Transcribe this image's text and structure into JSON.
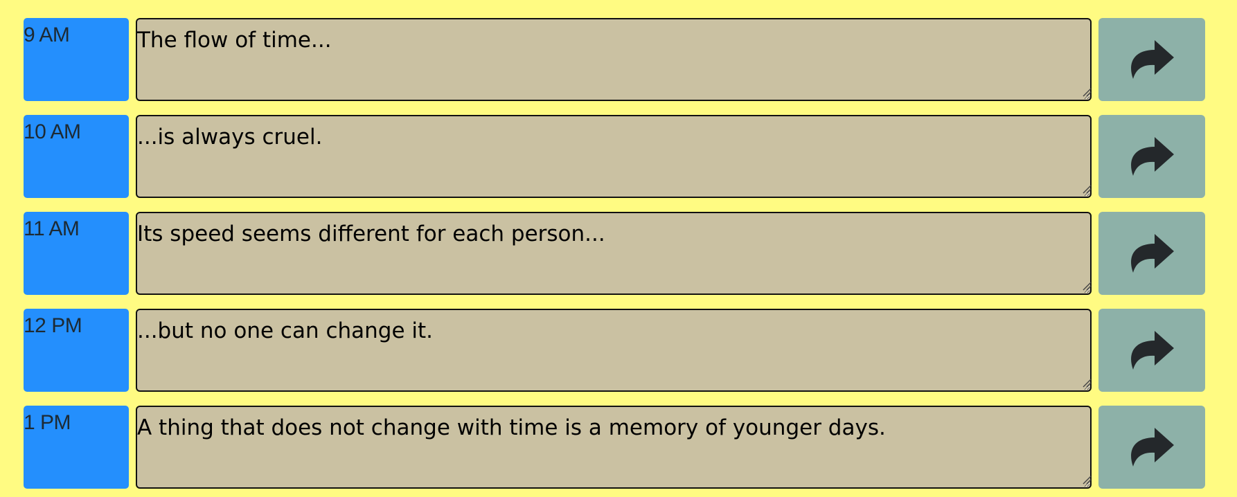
{
  "colors": {
    "page_background": "#fffb82",
    "hour_block": "#248ffd",
    "note_field": "#cac1a2",
    "save_button": "#8db1a8",
    "save_icon": "#24282b"
  },
  "rows": [
    {
      "hour": "9 AM",
      "note": "The flow of time...",
      "save_icon": "share-arrow-icon"
    },
    {
      "hour": "10 AM",
      "note": "...is always cruel.",
      "save_icon": "share-arrow-icon"
    },
    {
      "hour": "11 AM",
      "note": "Its speed seems different for each person...",
      "save_icon": "share-arrow-icon"
    },
    {
      "hour": "12 PM",
      "note": "...but no one can change it.",
      "save_icon": "share-arrow-icon"
    },
    {
      "hour": "1 PM",
      "note": "A thing that does not change with time is a memory of younger days.",
      "save_icon": "share-arrow-icon"
    }
  ]
}
